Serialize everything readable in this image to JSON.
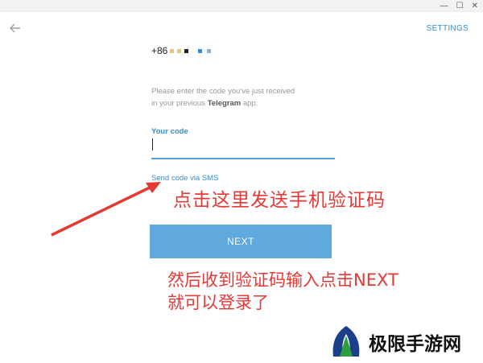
{
  "window": {
    "controls": [
      "—",
      "☐",
      "✕"
    ]
  },
  "header": {
    "back_icon": "arrow-left-icon",
    "settings_label": "SETTINGS"
  },
  "phone": {
    "prefix": "+86",
    "masked_dot_colors": [
      "#e8c27a",
      "#e0c58a",
      "#222222",
      "#3a8dcc",
      "#7fb6dd"
    ]
  },
  "hint": {
    "line1": "Please enter the code you've just received",
    "line2_prefix": "in your previous ",
    "line2_app": "Telegram",
    "line2_suffix": " app."
  },
  "code": {
    "label": "Your code",
    "value": ""
  },
  "sms_link": "Send code via SMS",
  "next_button": "NEXT",
  "annotations": {
    "tip1": "点击这里发送手机验证码",
    "tip2_line1": "然后收到验证码输入点击NEXT",
    "tip2_line2": "就可以登录了"
  },
  "watermark": {
    "text": "极限手游网"
  },
  "colors": {
    "accent": "#3a8dcc",
    "button": "#5fa9de",
    "annotation": "#e53935"
  }
}
